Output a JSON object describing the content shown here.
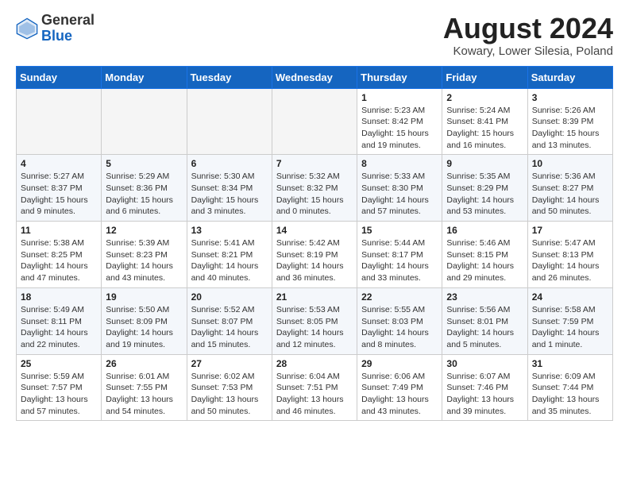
{
  "header": {
    "logo_general": "General",
    "logo_blue": "Blue",
    "month_year": "August 2024",
    "location": "Kowary, Lower Silesia, Poland"
  },
  "days_of_week": [
    "Sunday",
    "Monday",
    "Tuesday",
    "Wednesday",
    "Thursday",
    "Friday",
    "Saturday"
  ],
  "weeks": [
    [
      {
        "day": "",
        "empty": true
      },
      {
        "day": "",
        "empty": true
      },
      {
        "day": "",
        "empty": true
      },
      {
        "day": "",
        "empty": true
      },
      {
        "day": "1",
        "sunrise": "5:23 AM",
        "sunset": "8:42 PM",
        "daylight": "15 hours and 19 minutes."
      },
      {
        "day": "2",
        "sunrise": "5:24 AM",
        "sunset": "8:41 PM",
        "daylight": "15 hours and 16 minutes."
      },
      {
        "day": "3",
        "sunrise": "5:26 AM",
        "sunset": "8:39 PM",
        "daylight": "15 hours and 13 minutes."
      }
    ],
    [
      {
        "day": "4",
        "sunrise": "5:27 AM",
        "sunset": "8:37 PM",
        "daylight": "15 hours and 9 minutes."
      },
      {
        "day": "5",
        "sunrise": "5:29 AM",
        "sunset": "8:36 PM",
        "daylight": "15 hours and 6 minutes."
      },
      {
        "day": "6",
        "sunrise": "5:30 AM",
        "sunset": "8:34 PM",
        "daylight": "15 hours and 3 minutes."
      },
      {
        "day": "7",
        "sunrise": "5:32 AM",
        "sunset": "8:32 PM",
        "daylight": "15 hours and 0 minutes."
      },
      {
        "day": "8",
        "sunrise": "5:33 AM",
        "sunset": "8:30 PM",
        "daylight": "14 hours and 57 minutes."
      },
      {
        "day": "9",
        "sunrise": "5:35 AM",
        "sunset": "8:29 PM",
        "daylight": "14 hours and 53 minutes."
      },
      {
        "day": "10",
        "sunrise": "5:36 AM",
        "sunset": "8:27 PM",
        "daylight": "14 hours and 50 minutes."
      }
    ],
    [
      {
        "day": "11",
        "sunrise": "5:38 AM",
        "sunset": "8:25 PM",
        "daylight": "14 hours and 47 minutes."
      },
      {
        "day": "12",
        "sunrise": "5:39 AM",
        "sunset": "8:23 PM",
        "daylight": "14 hours and 43 minutes."
      },
      {
        "day": "13",
        "sunrise": "5:41 AM",
        "sunset": "8:21 PM",
        "daylight": "14 hours and 40 minutes."
      },
      {
        "day": "14",
        "sunrise": "5:42 AM",
        "sunset": "8:19 PM",
        "daylight": "14 hours and 36 minutes."
      },
      {
        "day": "15",
        "sunrise": "5:44 AM",
        "sunset": "8:17 PM",
        "daylight": "14 hours and 33 minutes."
      },
      {
        "day": "16",
        "sunrise": "5:46 AM",
        "sunset": "8:15 PM",
        "daylight": "14 hours and 29 minutes."
      },
      {
        "day": "17",
        "sunrise": "5:47 AM",
        "sunset": "8:13 PM",
        "daylight": "14 hours and 26 minutes."
      }
    ],
    [
      {
        "day": "18",
        "sunrise": "5:49 AM",
        "sunset": "8:11 PM",
        "daylight": "14 hours and 22 minutes."
      },
      {
        "day": "19",
        "sunrise": "5:50 AM",
        "sunset": "8:09 PM",
        "daylight": "14 hours and 19 minutes."
      },
      {
        "day": "20",
        "sunrise": "5:52 AM",
        "sunset": "8:07 PM",
        "daylight": "14 hours and 15 minutes."
      },
      {
        "day": "21",
        "sunrise": "5:53 AM",
        "sunset": "8:05 PM",
        "daylight": "14 hours and 12 minutes."
      },
      {
        "day": "22",
        "sunrise": "5:55 AM",
        "sunset": "8:03 PM",
        "daylight": "14 hours and 8 minutes."
      },
      {
        "day": "23",
        "sunrise": "5:56 AM",
        "sunset": "8:01 PM",
        "daylight": "14 hours and 5 minutes."
      },
      {
        "day": "24",
        "sunrise": "5:58 AM",
        "sunset": "7:59 PM",
        "daylight": "14 hours and 1 minute."
      }
    ],
    [
      {
        "day": "25",
        "sunrise": "5:59 AM",
        "sunset": "7:57 PM",
        "daylight": "13 hours and 57 minutes."
      },
      {
        "day": "26",
        "sunrise": "6:01 AM",
        "sunset": "7:55 PM",
        "daylight": "13 hours and 54 minutes."
      },
      {
        "day": "27",
        "sunrise": "6:02 AM",
        "sunset": "7:53 PM",
        "daylight": "13 hours and 50 minutes."
      },
      {
        "day": "28",
        "sunrise": "6:04 AM",
        "sunset": "7:51 PM",
        "daylight": "13 hours and 46 minutes."
      },
      {
        "day": "29",
        "sunrise": "6:06 AM",
        "sunset": "7:49 PM",
        "daylight": "13 hours and 43 minutes."
      },
      {
        "day": "30",
        "sunrise": "6:07 AM",
        "sunset": "7:46 PM",
        "daylight": "13 hours and 39 minutes."
      },
      {
        "day": "31",
        "sunrise": "6:09 AM",
        "sunset": "7:44 PM",
        "daylight": "13 hours and 35 minutes."
      }
    ]
  ]
}
